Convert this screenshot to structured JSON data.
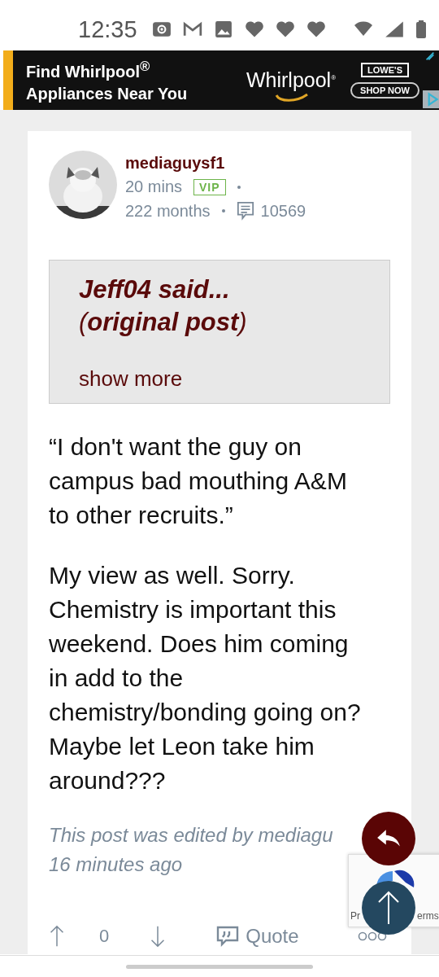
{
  "status_bar": {
    "time": "12:35"
  },
  "ad": {
    "headline": [
      "Find Whirlpool$^{®}$",
      "Appliances Near You"
    ],
    "brand": "Whirlpool",
    "brand_mark": "®",
    "retailer": "LOWE'S",
    "cta": "SHOP NOW"
  },
  "post": {
    "author": "mediaguysf1",
    "time": "20 mins",
    "badge": "VIP",
    "tenure": "222 months",
    "post_count": "10569",
    "quote": {
      "author_line": "Jeff04 said...",
      "source_line": "(**original post**)",
      "toggle": "show more"
    },
    "paragraphs": [
      "“I don't want the guy on campus bad mouthing A&M to other recruits.”",
      "My view as well. Sorry. Chemistry is important this weekend. Does him coming in add to the chemistry/bonding going on? Maybe let Leon take him around???"
    ],
    "edit_note": [
      "This post was edited by mediagu",
      "16 minutes ago"
    ],
    "votes": "0",
    "quote_action": "Quote"
  },
  "recaptcha": {
    "left": "Pr",
    "right": "erms"
  }
}
